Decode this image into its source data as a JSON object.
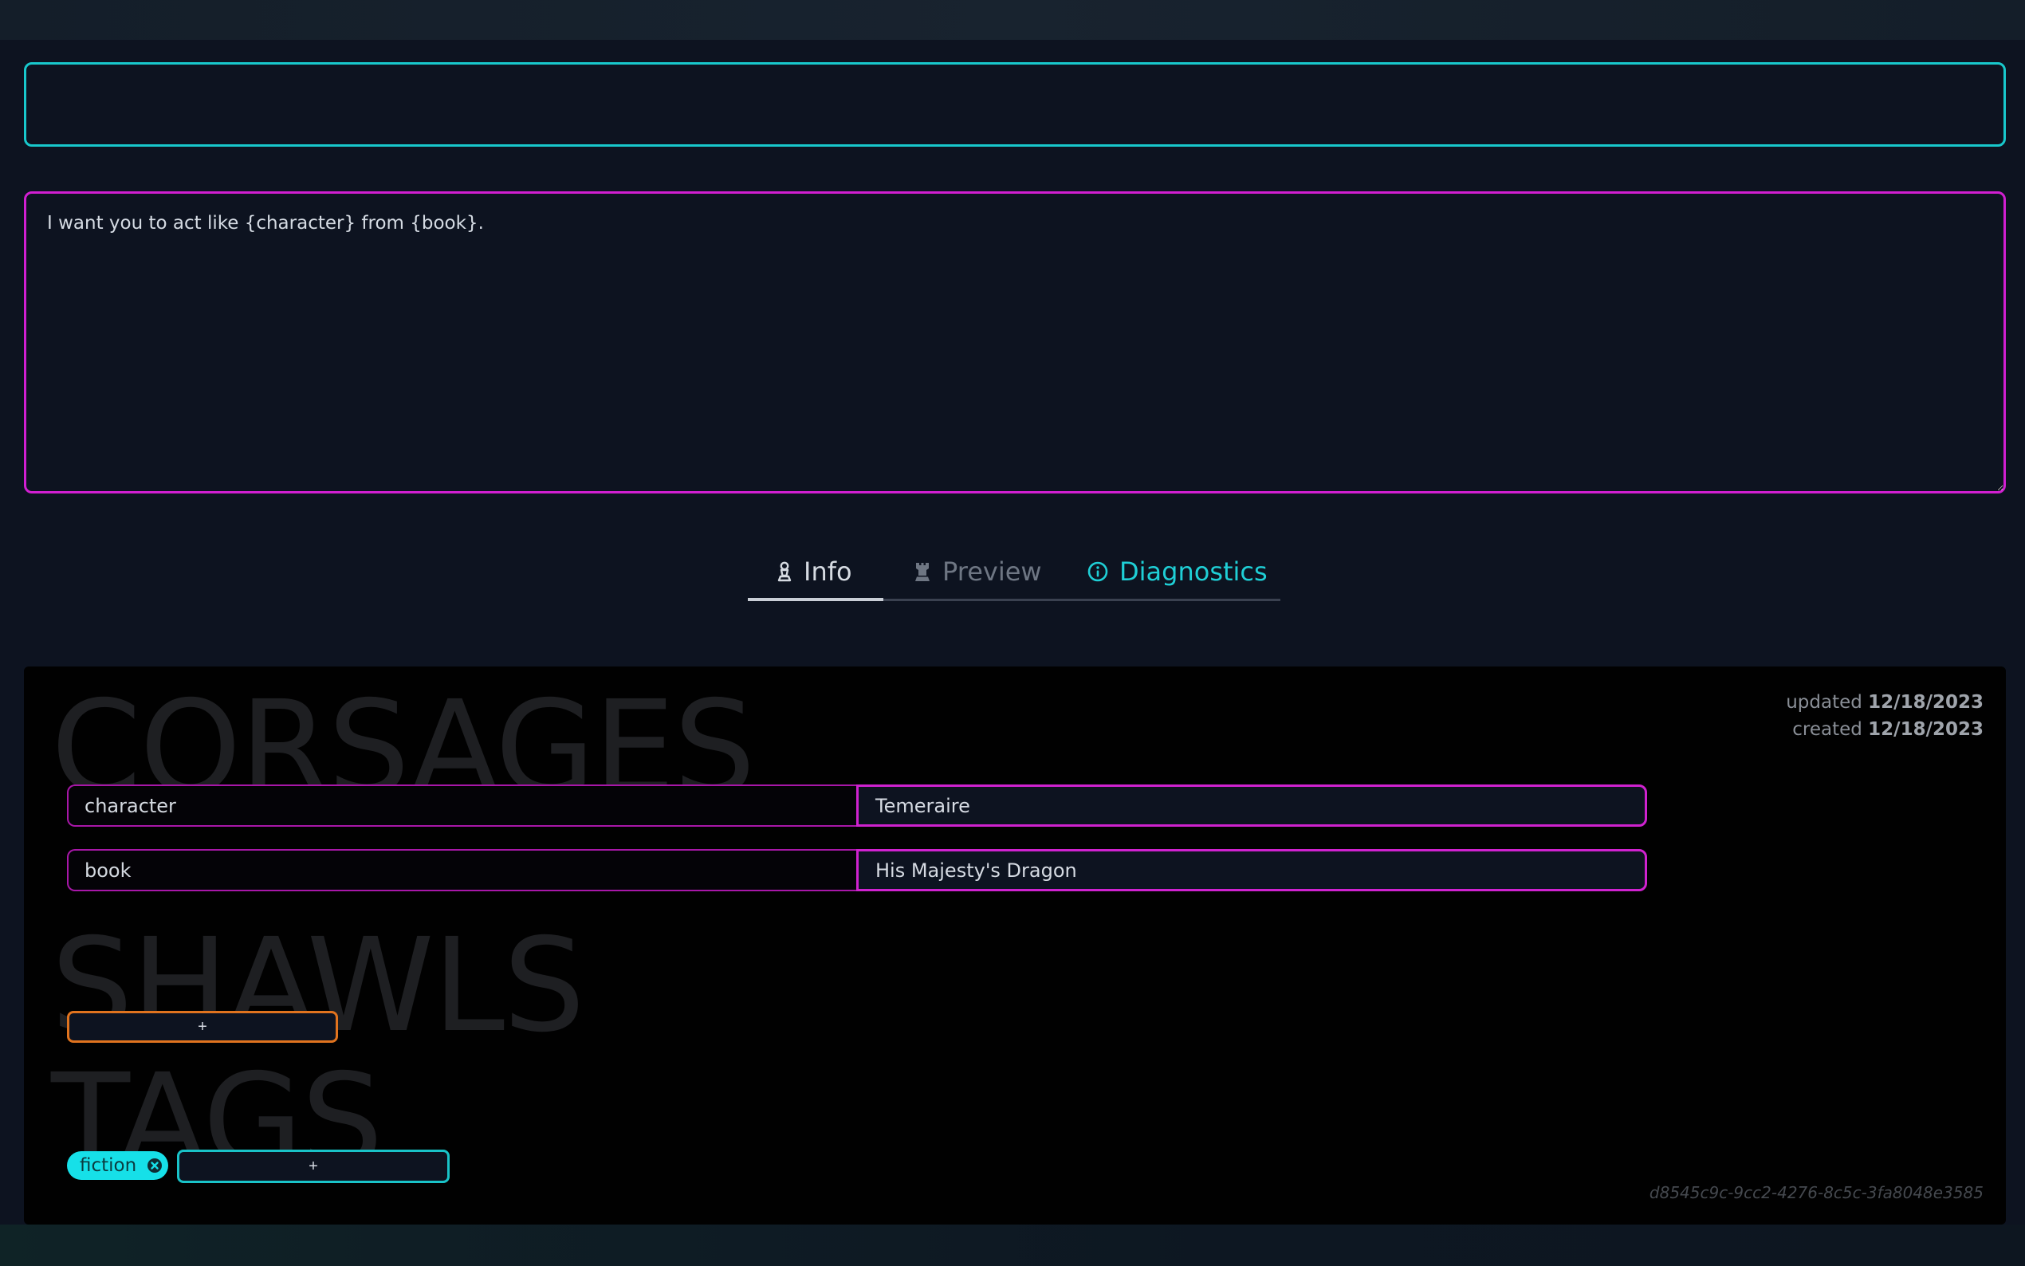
{
  "title_input": {
    "value": "",
    "placeholder": ""
  },
  "prompt": {
    "value": "I want you to act like {character} from {book}."
  },
  "tabs": [
    {
      "label": "Info",
      "icon": "chess-pawn-icon",
      "state": "active"
    },
    {
      "label": "Preview",
      "icon": "chess-rook-icon",
      "state": "inactive"
    },
    {
      "label": "Diagnostics",
      "icon": "info-circle-icon",
      "state": "highlighted",
      "color": "#1fcfd6"
    }
  ],
  "meta": {
    "updated_label": "updated",
    "updated_value": "12/18/2023",
    "created_label": "created",
    "created_value": "12/18/2023"
  },
  "sections": {
    "corsages": "CORSAGES",
    "shawls": "SHAWLS",
    "tags": "TAGS"
  },
  "corsages": [
    {
      "key": "character",
      "value": "Temeraire"
    },
    {
      "key": "book",
      "value": "His Majesty's Dragon"
    }
  ],
  "shawls": {
    "add_label": "+"
  },
  "tags": {
    "items": [
      {
        "label": "fiction"
      }
    ],
    "add_label": "+"
  },
  "uuid": "d8545c9c-9cc2-4276-8c5c-3fa8048e3585",
  "colors": {
    "background": "#0d1320",
    "panel": "#010101",
    "cyan_accent": "#18c8cc",
    "magenta_accent": "#d11fd1",
    "orange_accent": "#e0731e",
    "tag_chip": "#16e0e8"
  }
}
